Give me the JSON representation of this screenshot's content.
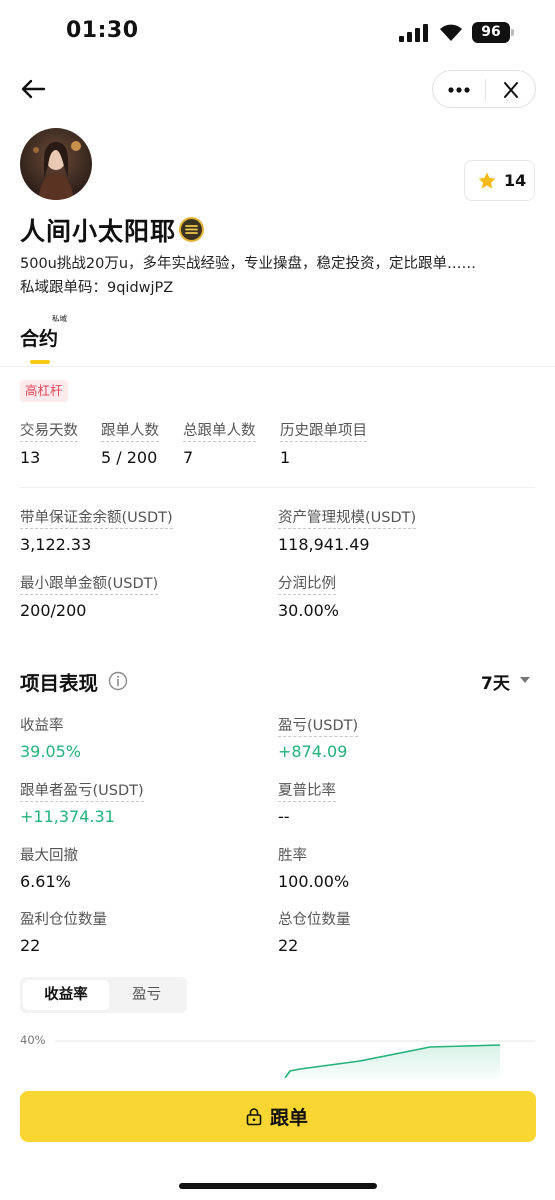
{
  "status_bar": {
    "time": "01:30",
    "battery": "96"
  },
  "profile": {
    "name": "人间小太阳耶",
    "bio": "500u挑战20万u，多年实战经验，专业操盘，稳定投资，定比跟单……",
    "invite_code": "私域跟单码：9qidwjPZ",
    "favorite_count": "14"
  },
  "tabs": {
    "contract": "合约",
    "contract_tag": "私域"
  },
  "leverage_tag": "高杠杆",
  "overview": [
    {
      "label": "交易天数",
      "value": "13"
    },
    {
      "label": "跟单人数",
      "value": "5 / 200"
    },
    {
      "label": "总跟单人数",
      "value": "7"
    },
    {
      "label": "历史跟单项目",
      "value": "1"
    }
  ],
  "funds": [
    {
      "label": "带单保证金余额(USDT)",
      "value": "3,122.33"
    },
    {
      "label": "资产管理规模(USDT)",
      "value": "118,941.49"
    },
    {
      "label": "最小跟单金额(USDT)",
      "value": "200/200"
    },
    {
      "label": "分润比例",
      "value": "30.00%"
    }
  ],
  "performance": {
    "title": "项目表现",
    "period": "7天",
    "metrics": [
      {
        "label": "收益率",
        "value": "39.05%"
      },
      {
        "label": "盈亏(USDT)",
        "value": "+874.09"
      },
      {
        "label": "跟单者盈亏(USDT)",
        "value": "+11,374.31"
      },
      {
        "label": "夏普比率",
        "value": "--"
      },
      {
        "label": "最大回撤",
        "value": "6.61%"
      },
      {
        "label": "胜率",
        "value": "100.00%"
      },
      {
        "label": "盈利仓位数量",
        "value": "22"
      },
      {
        "label": "总仓位数量",
        "value": "22"
      }
    ],
    "chart_tabs": [
      "收益率",
      "盈亏"
    ],
    "chart_ylabel": "40%"
  },
  "follow_button": "跟单",
  "colors": {
    "brand_yellow": "#f9d631",
    "profit_green": "#22b27b",
    "tag_red": "#e1485b"
  }
}
